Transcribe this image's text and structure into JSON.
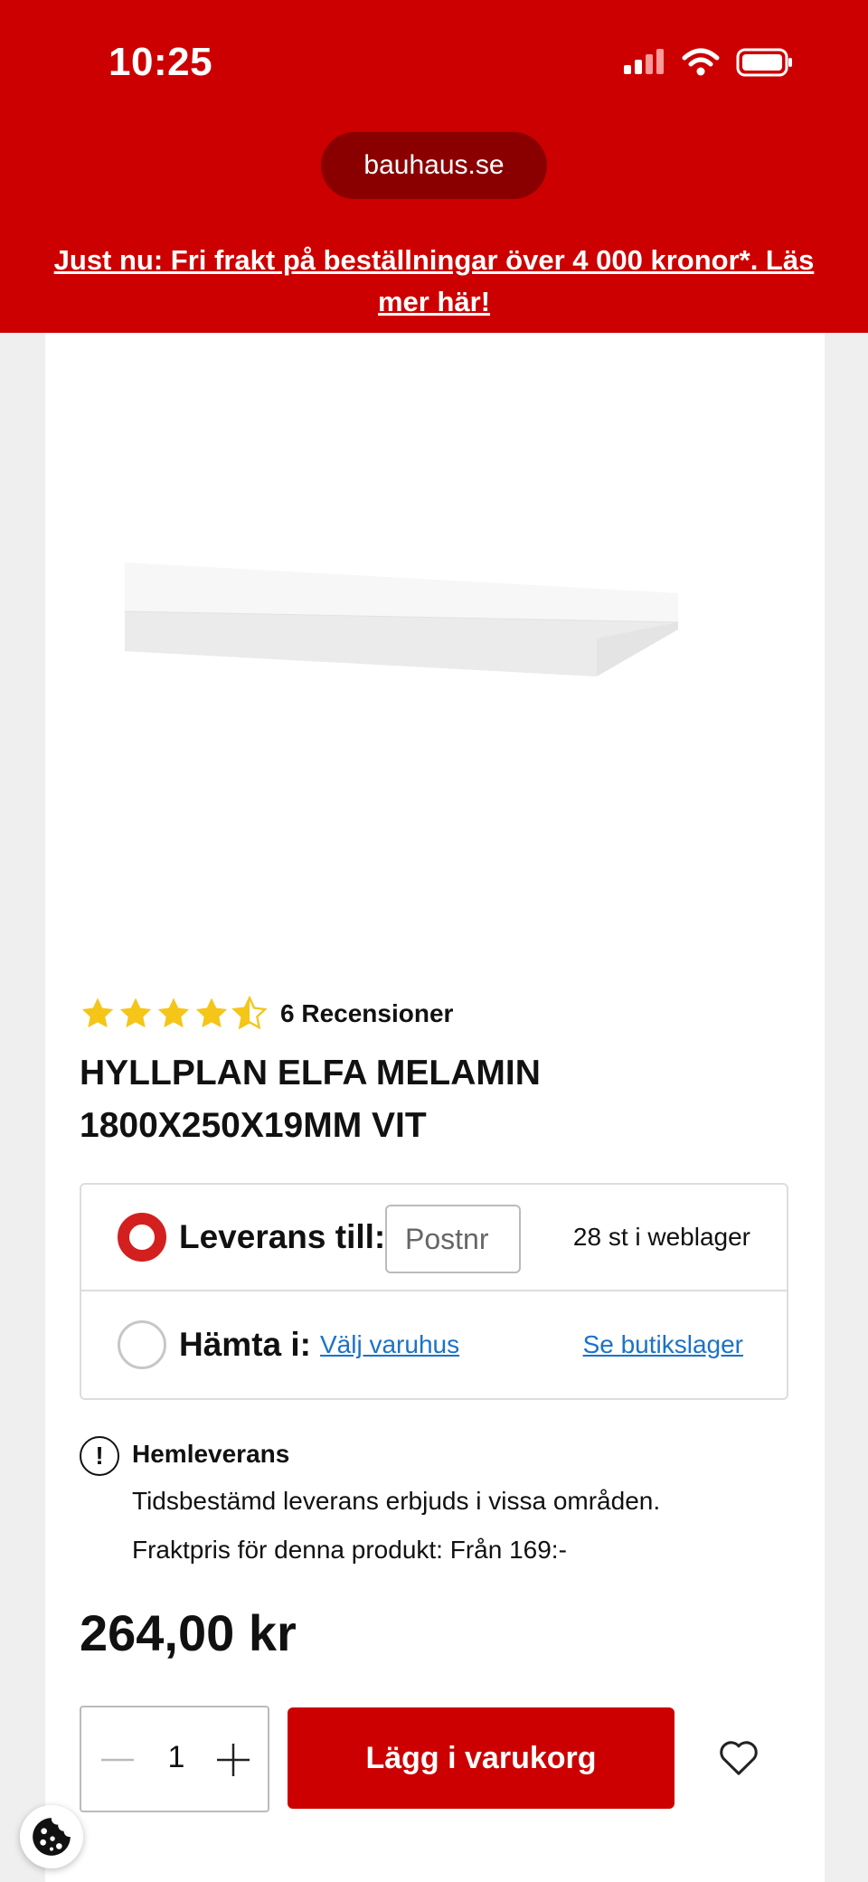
{
  "status_bar": {
    "time": "10:25"
  },
  "browser": {
    "url": "bauhaus.se"
  },
  "promo_banner": {
    "text": "Just nu: Fri frakt på beställningar över 4 000 kronor*. Läs mer här!"
  },
  "product": {
    "rating": {
      "stars": 4.5,
      "max": 5,
      "reviews_label": "6 Recensioner"
    },
    "title": "HYLLPLAN ELFA MELAMIN 1800X250X19MM VIT",
    "price": "264,00 kr"
  },
  "delivery": {
    "delivery_label": "Leverans till:",
    "postnr_placeholder": "Postnr",
    "stock_text": "28 st i weblager",
    "pickup_label": "Hämta i:",
    "choose_store_link": "Välj varuhus",
    "see_stock_link": "Se butikslager"
  },
  "info": {
    "heading": "Hemleverans",
    "line1": "Tidsbestämd leverans erbjuds i vissa områden.",
    "line2": "Fraktpris för denna produkt: Från 169:-"
  },
  "cart": {
    "quantity": "1",
    "add_button": "Lägg i varukorg"
  },
  "colors": {
    "brand_red": "#cc0000",
    "link_blue": "#1a73c8",
    "star_yellow": "#f5c518"
  }
}
